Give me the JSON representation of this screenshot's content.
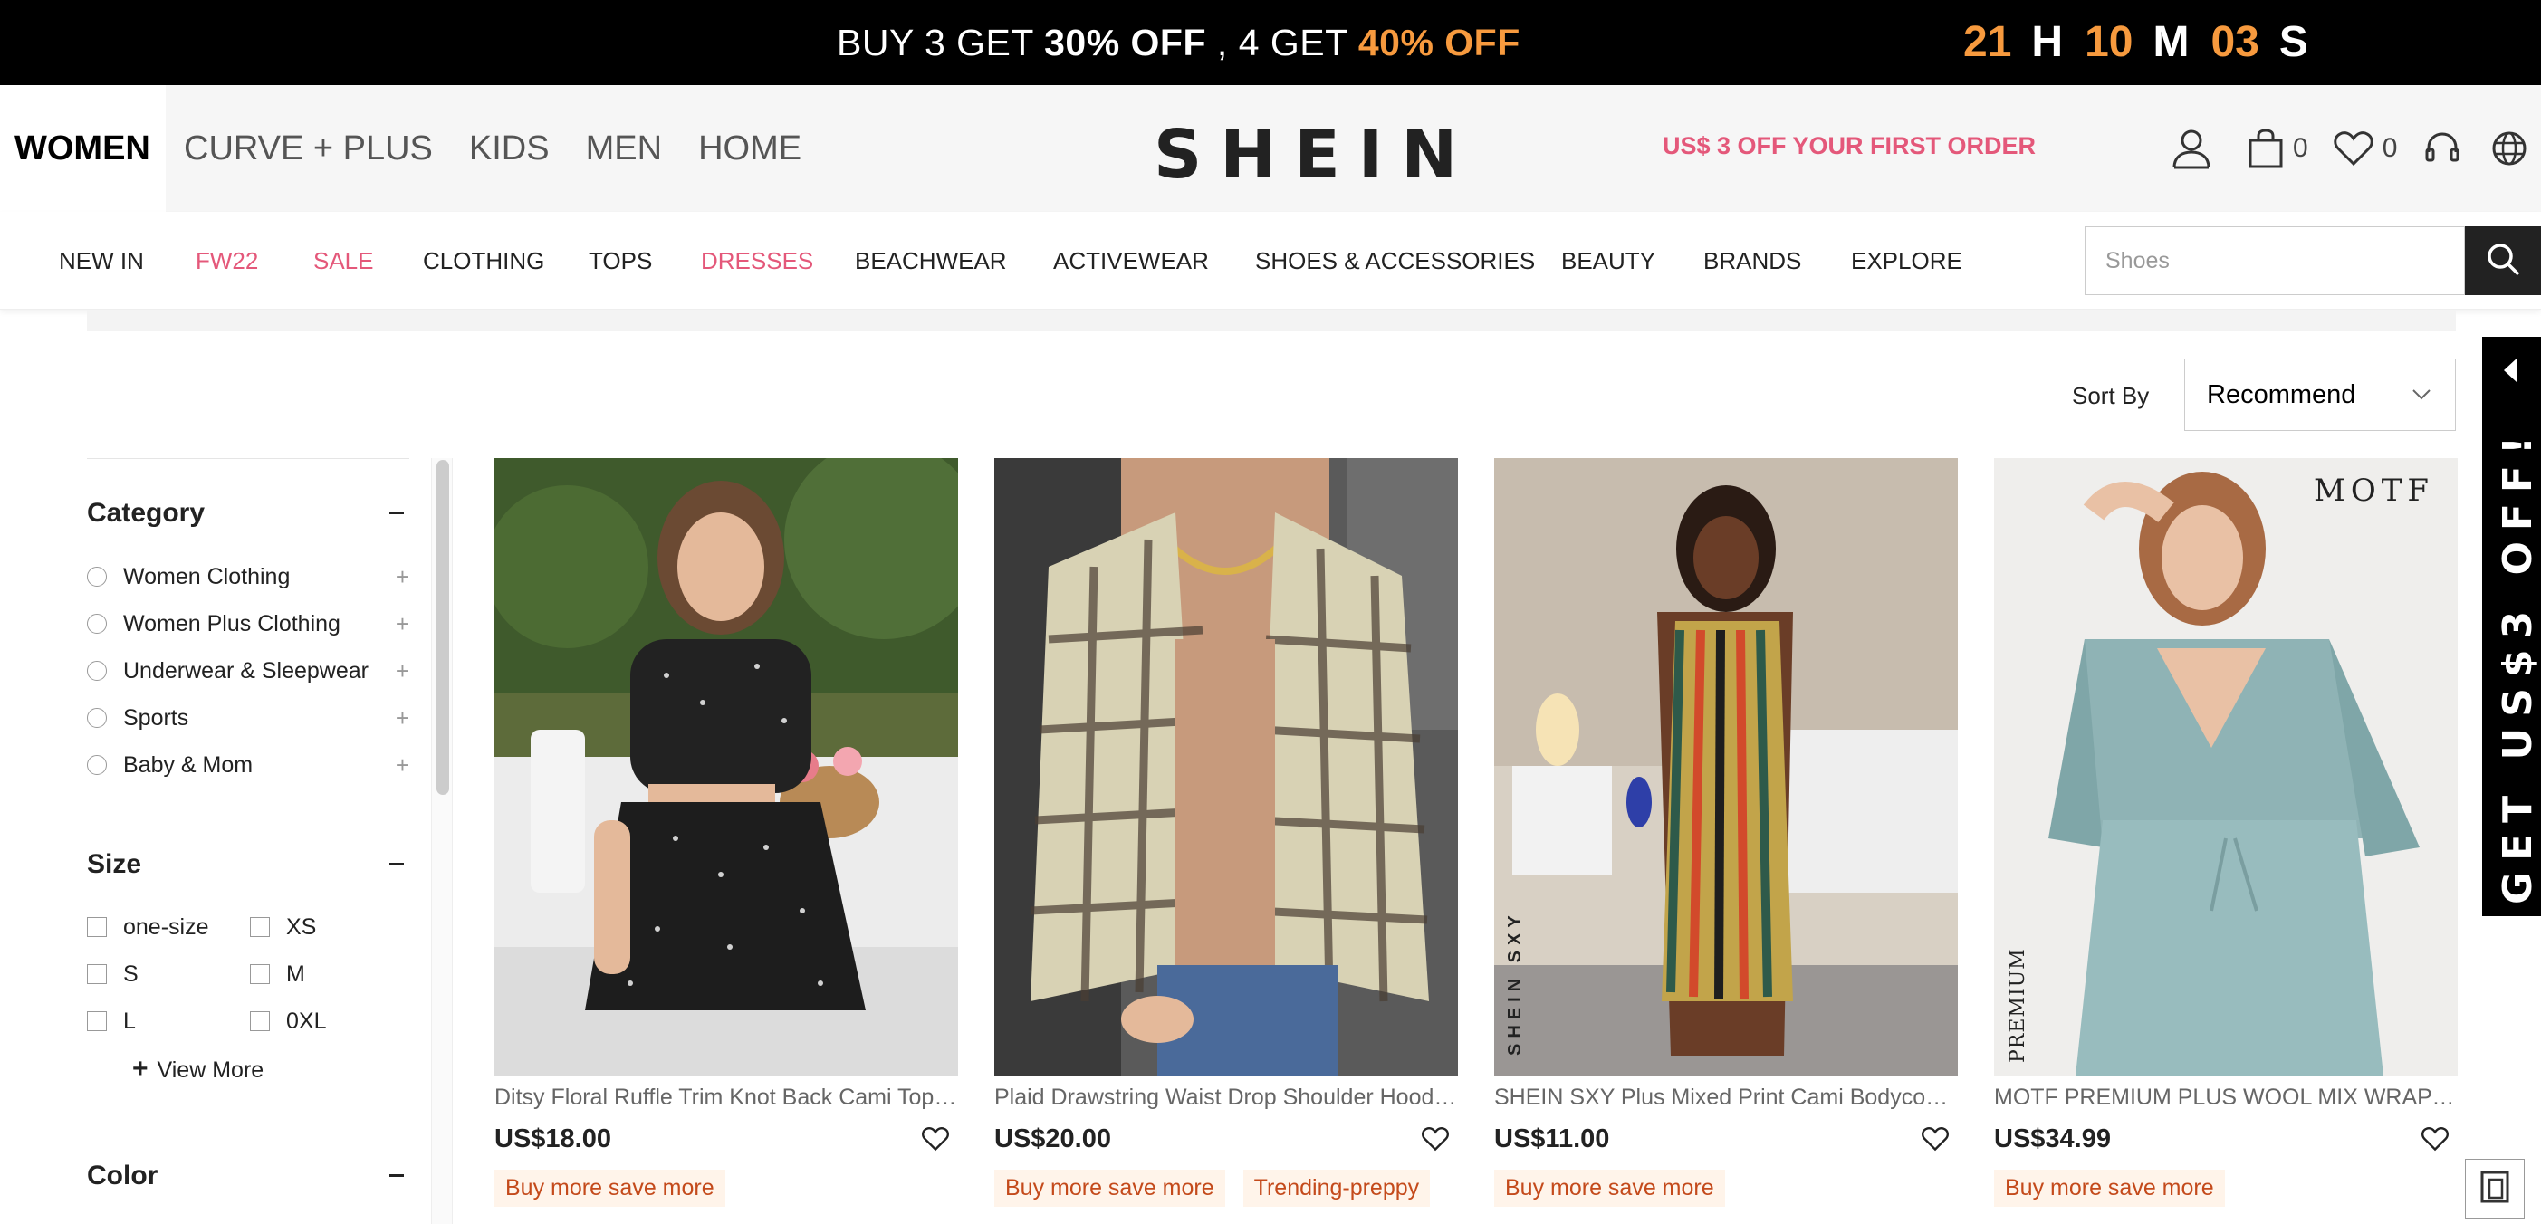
{
  "promo_bar": {
    "part1": "BUY 3 GET ",
    "part2": "30% OFF",
    "part3": " , 4 GET ",
    "part4": "40% OFF",
    "countdown": {
      "hours": "21",
      "h_unit": "H",
      "minutes": "10",
      "m_unit": "M",
      "seconds": "03",
      "s_unit": "S"
    }
  },
  "header": {
    "tabs": [
      "WOMEN",
      "CURVE + PLUS",
      "KIDS",
      "MEN",
      "HOME"
    ],
    "logo": "SHEIN",
    "first_order": "US$ 3 OFF YOUR FIRST ORDER",
    "cart_count": "0",
    "wishlist_count": "0",
    "icons": [
      "user-icon",
      "bag-icon",
      "heart-icon",
      "headset-icon",
      "globe-icon"
    ]
  },
  "nav": {
    "items": [
      {
        "label": "NEW IN"
      },
      {
        "label": "FW22"
      },
      {
        "label": "SALE"
      },
      {
        "label": "CLOTHING"
      },
      {
        "label": "TOPS"
      },
      {
        "label": "DRESSES"
      },
      {
        "label": "BEACHWEAR"
      },
      {
        "label": "ACTIVEWEAR"
      },
      {
        "label": "SHOES & ACCESSORIES"
      },
      {
        "label": "BEAUTY"
      },
      {
        "label": "BRANDS"
      },
      {
        "label": "EXPLORE"
      }
    ],
    "highlight_color": "#e4587a",
    "search_placeholder": "Shoes"
  },
  "sort": {
    "label": "Sort By",
    "value": "Recommend"
  },
  "side_promo": {
    "text": "GET US$3 OFF!"
  },
  "filters": {
    "category": {
      "title": "Category",
      "items": [
        "Women Clothing",
        "Women Plus Clothing",
        "Underwear & Sleepwear",
        "Sports",
        "Baby & Mom"
      ]
    },
    "size": {
      "title": "Size",
      "options": [
        "one-size",
        "XS",
        "S",
        "M",
        "L",
        "0XL"
      ],
      "view_more": "View More"
    },
    "color": {
      "title": "Color"
    }
  },
  "products": [
    {
      "title": "Ditsy Floral Ruffle Trim Knot Back Cami Top & Skirt",
      "price": "US$18.00",
      "tags": [
        "Buy more save more"
      ]
    },
    {
      "title": "Plaid Drawstring Waist Drop Shoulder Hooded Jacket",
      "price": "US$20.00",
      "tags": [
        "Buy more save more",
        "Trending-preppy"
      ]
    },
    {
      "title": "SHEIN SXY Plus Mixed Print Cami Bodycon Dress",
      "price": "US$11.00",
      "tags": [
        "Buy more save more"
      ],
      "image_text": "SHEIN SXY"
    },
    {
      "title": "MOTF PREMIUM PLUS WOOL MIX WRAP SWEATER",
      "price": "US$34.99",
      "tags": [
        "Buy more save more"
      ],
      "image_text_top": "MOTF",
      "image_text_side": "PREMIUM"
    }
  ]
}
